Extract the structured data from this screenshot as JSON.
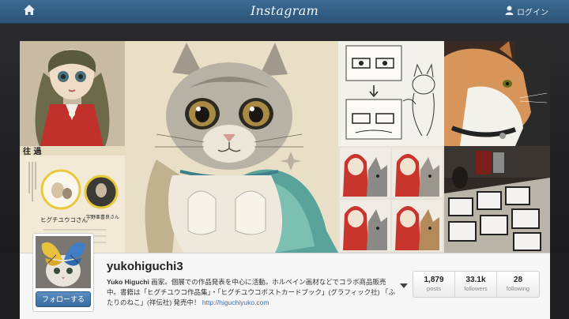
{
  "header": {
    "logo": "Instagram",
    "login_label": "ログイン",
    "icons": {
      "home": "home-icon",
      "user": "user-icon"
    }
  },
  "gallery": {
    "items": [
      {
        "name": "photo-girl-portrait",
        "overlay_text": ""
      },
      {
        "name": "photo-cat-painting",
        "overlay_text": ""
      },
      {
        "name": "photo-sketch-glasses",
        "overlay_text": ""
      },
      {
        "name": "photo-cat-closeup",
        "overlay_text": ""
      },
      {
        "name": "photo-book-page",
        "overlay_text": ""
      },
      {
        "name": "photo-red-hood-wolf",
        "overlay_text": ""
      },
      {
        "name": "photo-gallery-frames",
        "overlay_text": ""
      }
    ],
    "book_page": {
      "header_text": "往 過",
      "left_caption": "ヒグチユウコさん",
      "right_caption": "宇野亜喜良さん"
    }
  },
  "profile": {
    "username": "yukohiguchi3",
    "bio_name": "Yuko Higuchi",
    "bio_text": " 画家。個展での作品発表を中心に活動。ホルベイン画材などでコラボ商品販売中。書籍は「ヒグチユウコ作品集」・「ヒグチユウコポストカードブック」(グラフィック社) 「ふたりのねこ」(祥伝社) 発売中！ ",
    "bio_link": "http://higuchiyuko.com",
    "follow_label": "フォローする",
    "stats": [
      {
        "value": "1,879",
        "label": "posts"
      },
      {
        "value": "33.1k",
        "label": "followers"
      },
      {
        "value": "28",
        "label": "following"
      }
    ]
  },
  "colors": {
    "header_bg": "#2c5477",
    "follow_button": "#3a6c9e",
    "link": "#3d6fa3"
  }
}
